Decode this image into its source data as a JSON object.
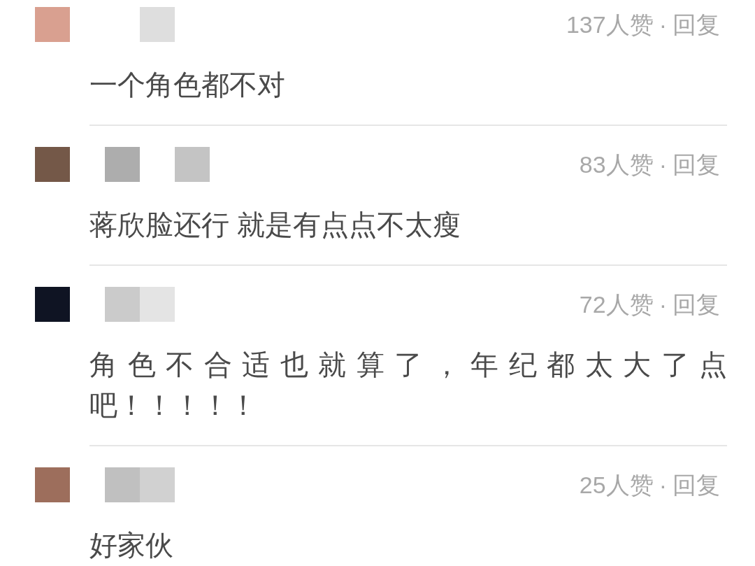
{
  "comments": [
    {
      "color": "#d9a090",
      "name_tiles": [
        {
          "kind": "gap"
        },
        {
          "kind": "tile",
          "color": "#dedede"
        }
      ],
      "likes": "137人赞",
      "separator": "·",
      "reply": "回复",
      "text": "一个角色都不对"
    },
    {
      "color": "#745848",
      "name_tiles": [
        {
          "kind": "tile",
          "color": "#adadad"
        },
        {
          "kind": "gap"
        },
        {
          "kind": "tile",
          "color": "#c4c4c4"
        }
      ],
      "likes": "83人赞",
      "separator": "·",
      "reply": "回复",
      "text": "蒋欣脸还行 就是有点点不太瘦"
    },
    {
      "color": "#0f1423",
      "name_tiles": [
        {
          "kind": "tile",
          "color": "#cbcbcb"
        },
        {
          "kind": "tile",
          "color": "#e4e4e4"
        }
      ],
      "likes": "72人赞",
      "separator": "·",
      "reply": "回复",
      "text": "角色不合适也就算了，年纪都太大了点吧！！！！！"
    },
    {
      "color": "#9d6e5c",
      "name_tiles": [
        {
          "kind": "tile",
          "color": "#c0c0c0"
        },
        {
          "kind": "tile",
          "color": "#d1d1d1"
        }
      ],
      "likes": "25人赞",
      "separator": "·",
      "reply": "回复",
      "text": "好家伙"
    }
  ]
}
